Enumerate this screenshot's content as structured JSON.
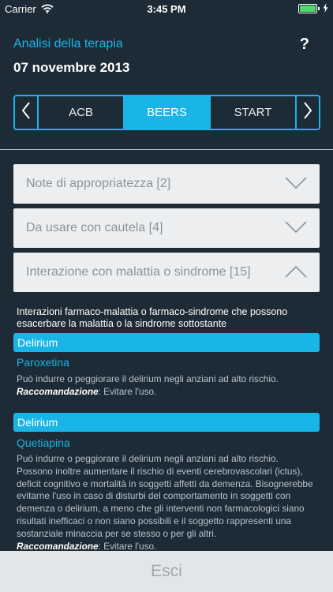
{
  "status": {
    "carrier": "Carrier",
    "time": "3:45 PM",
    "battery_level": 0.9
  },
  "header": {
    "title": "Analisi della terapia",
    "date": "07 novembre 2013",
    "help_label": "?"
  },
  "tabs": [
    {
      "label": "ACB",
      "active": false
    },
    {
      "label": "BEERS",
      "active": true
    },
    {
      "label": "START",
      "active": false
    }
  ],
  "sections": [
    {
      "label": "Note di appropriatezza [2]",
      "expanded": false
    },
    {
      "label": "Da usare con cautela [4]",
      "expanded": false
    },
    {
      "label": "Interazione con malattia o sindrome [15]",
      "expanded": true
    }
  ],
  "section_description": "Interazioni farmaco-malattia o farmaco-sindrome che possono esacerbare la malattia o la sindrome sottostante",
  "entries": [
    {
      "category": "Delirium",
      "drug": "Paroxetina",
      "text": "Può indurre o peggiorare il delirium negli anziani ad alto rischio.",
      "rec_label": "Raccomandazione",
      "rec_text": ": Evitare l'uso."
    },
    {
      "category": "Delirium",
      "drug": "Quetiapina",
      "text": "Può indurre o peggiorare il delirium negli anziani ad alto rischio. Possono inoltre aumentare il rischio di eventi cerebrovascolari (ictus), deficit cognitivo e mortalità in soggetti affetti da demenza. Bisognerebbe evitarne l'uso in caso di disturbi del comportamento in soggetti con demenza o delirium, a meno che gli interventi non farmacologici siano risultati inefficaci o non siano possibili e il soggetto rappresenti una sostanziale minaccia per se stesso o per gli altri.",
      "rec_label": "Raccomandazione",
      "rec_text": ": Evitare l'uso."
    }
  ],
  "footer": {
    "exit_label": "Esci"
  },
  "colors": {
    "accent": "#19b5e6",
    "background": "#1d2b36",
    "panel": "#eceeef"
  },
  "icons": [
    "wifi-icon",
    "battery-icon",
    "chevron-left-icon",
    "chevron-right-icon",
    "chevron-down-icon",
    "chevron-up-icon"
  ]
}
